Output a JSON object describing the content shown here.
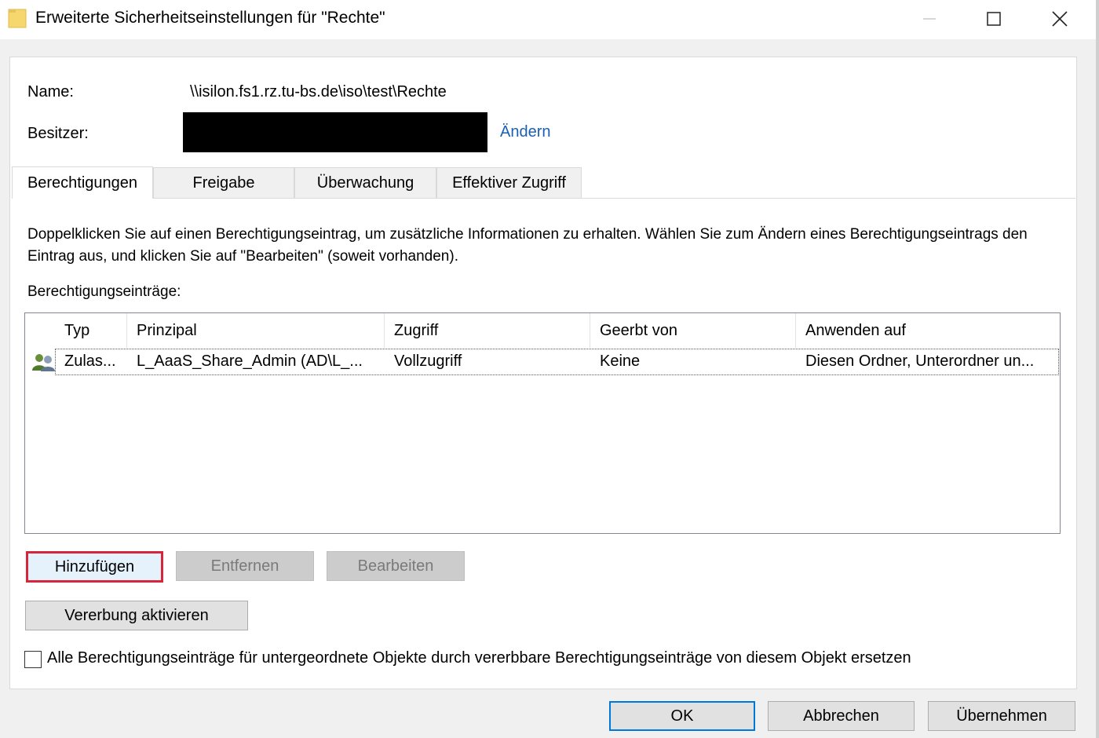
{
  "window": {
    "title": "Erweiterte Sicherheitseinstellungen für \"Rechte\"",
    "icon": "folder-icon"
  },
  "info": {
    "name_label": "Name:",
    "name_value": "\\\\isilon.fs1.rz.tu-bs.de\\iso\\test\\Rechte",
    "owner_label": "Besitzer:",
    "change_link": "Ändern"
  },
  "tabs": [
    {
      "label": "Berechtigungen",
      "active": true
    },
    {
      "label": "Freigabe"
    },
    {
      "label": "Überwachung"
    },
    {
      "label": "Effektiver Zugriff"
    }
  ],
  "description": "Doppelklicken Sie auf einen Berechtigungseintrag, um zusätzliche Informationen zu erhalten. Wählen Sie zum Ändern eines Berechtigungseintrags den Eintrag aus, und klicken Sie auf \"Bearbeiten\" (soweit vorhanden).",
  "entries_label": "Berechtigungseinträge:",
  "table": {
    "columns": [
      "Typ",
      "Prinzipal",
      "Zugriff",
      "Geerbt von",
      "Anwenden auf"
    ],
    "rows": [
      {
        "icon": "users-icon",
        "cells": [
          "Zulas...",
          "L_AaaS_Share_Admin (AD\\L_...",
          "Vollzugriff",
          "Keine",
          "Diesen Ordner, Unterordner un..."
        ]
      }
    ]
  },
  "buttons": {
    "add": "Hinzufügen",
    "remove": "Entfernen",
    "edit": "Bearbeiten",
    "inherit": "Vererbung aktivieren"
  },
  "replace_checkbox": {
    "label": "Alle Berechtigungseinträge für untergeordnete Objekte durch vererbbare Berechtigungseinträge von diesem Objekt ersetzen",
    "checked": false
  },
  "footer": {
    "ok": "OK",
    "cancel": "Abbrechen",
    "apply": "Übernehmen"
  },
  "colors": {
    "link": "#1a5fb4",
    "highlight_border": "#d6263b",
    "default_button_border": "#0078d7"
  }
}
